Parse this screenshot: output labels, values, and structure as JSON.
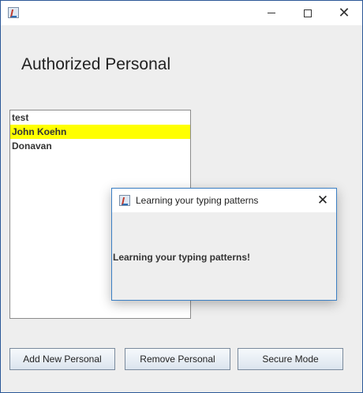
{
  "window": {
    "controls": {
      "minimize": "—",
      "maximize": "",
      "close": "✕"
    }
  },
  "main": {
    "heading": "Authorized Personal",
    "personnel": [
      {
        "name": "test",
        "selected": false
      },
      {
        "name": "John Koehn",
        "selected": true
      },
      {
        "name": "Donavan",
        "selected": false
      }
    ],
    "buttons": {
      "add": "Add New Personal",
      "remove": "Remove Personal",
      "secure": "Secure Mode"
    }
  },
  "dialog": {
    "title": "Learning your typing patterns",
    "message": "Learning your typing patterns!",
    "close": "✕"
  },
  "colors": {
    "selection": "#ffff00",
    "window_border": "#2b5797",
    "dialog_border": "#3b7fc4"
  }
}
